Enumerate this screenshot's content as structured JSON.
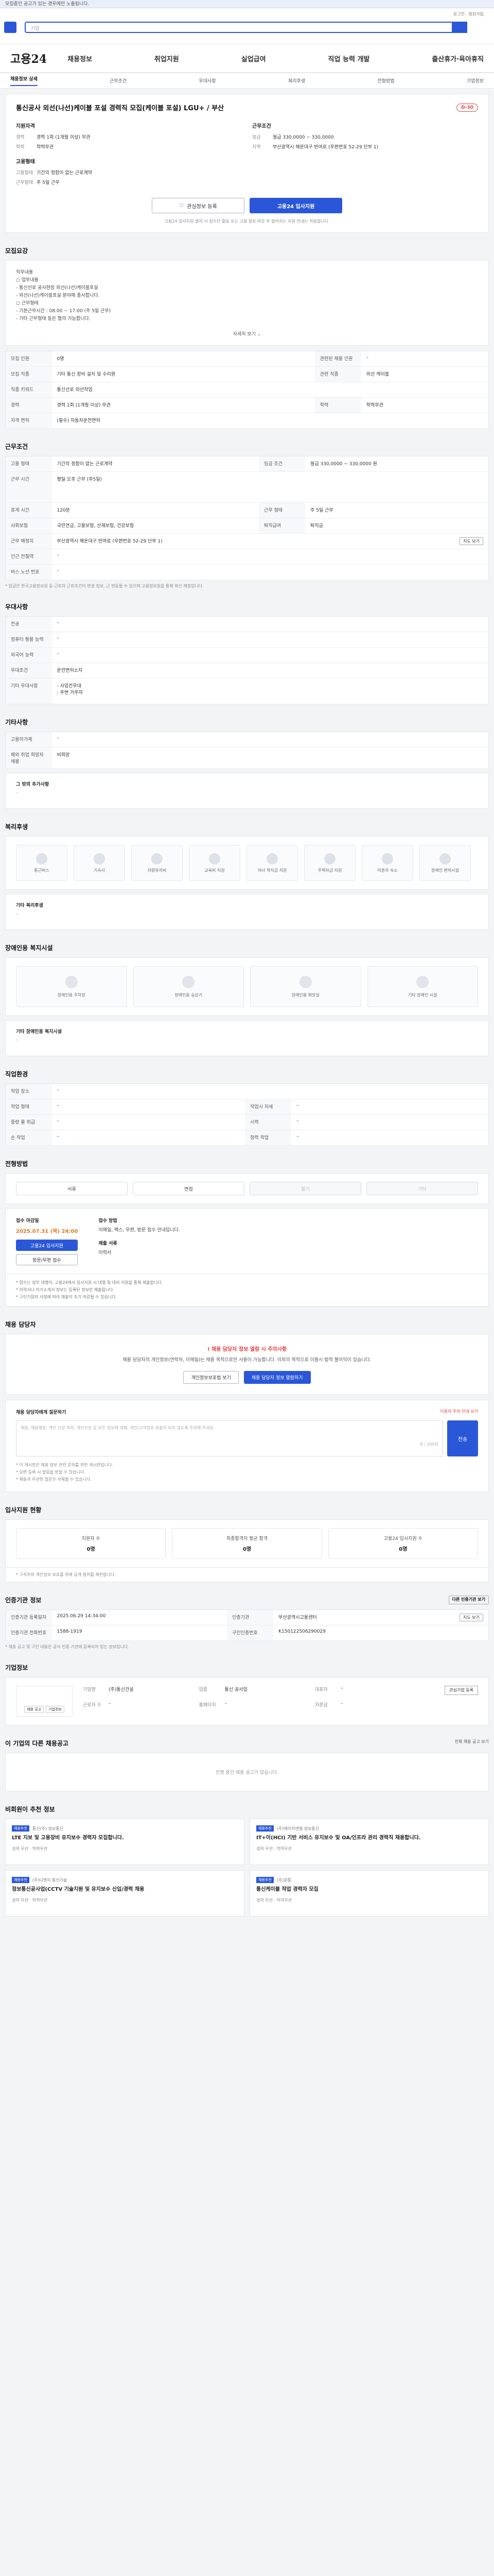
{
  "notice": "모집중인 공고가 있는 경우에만 노출됩니다.",
  "topbar": {
    "links": "로그인 · 회원가입",
    "search_placeholder": "기업"
  },
  "gnb": {
    "brand": "고용24",
    "menu": [
      "채용정보",
      "취업지원",
      "실업급여",
      "직업 능력 개발",
      "출산휴가·육아휴직"
    ]
  },
  "subnav": [
    "채용정보 상세",
    "근무조건",
    "우대사항",
    "복리후생",
    "전형방법",
    "기업정보"
  ],
  "job": {
    "title": "통신공사 외선(나선)케이블 포설 경력직 모집(케이블 포설) LGU+ / 부산",
    "dday": "D-30",
    "left_title": "지원자격",
    "left": [
      {
        "k": "경력",
        "v": "경력 1회 (1개월 이상) 무관"
      },
      {
        "k": "학력",
        "v": "학력무관"
      }
    ],
    "left2_title": "고용형태",
    "left2": [
      {
        "k": "고용형태",
        "v": "기간의 정함이 없는 근로계약"
      },
      {
        "k": "근무형태",
        "v": "주 5일 근무"
      }
    ],
    "right_title": "근무조건",
    "right": [
      {
        "k": "임금",
        "v": "월급 330,0000 ~ 330,0000"
      },
      {
        "k": "지역",
        "v": "부산광역시 해운대구 반여로 (우편번호 52-29 단부 1)"
      }
    ],
    "actions": {
      "fav": "관심정보 등록",
      "apply": "고용24 입사지원"
    },
    "action_note": "고용24 입사지원 클릭 시 접수단 활동 또는 고용 정보 마감 후 알려지는 지원 안내는 적용합니다."
  },
  "sections": {
    "recruit": "모집요강",
    "work": "근무조건",
    "pref": "우대사항",
    "other": "기타사항",
    "benefit": "복리후생",
    "disab": "장애인용 복지시설",
    "process": "직업환경",
    "method": "전형방법",
    "contact": "채용 담당자",
    "stats": "입사지원 현황",
    "register": "인증기관 정보",
    "company": "기업정보",
    "similar": "이 기업의 다른 채용공고",
    "reco": "비회원이 추천 정보"
  },
  "recruit_desc": [
    "직무내용",
    "○ 업무내용",
    "- 통신선로 공사현장 외선(나선)케이블포설",
    "- 외선(나선)케이블포설 분야에 종사합니다.",
    "○ 근무형태",
    "- 기본근무시간 : 08:00 ~ 17:00 (주 5일 근무)",
    "- 기타 근무형태 등은 협의 가능합니다."
  ],
  "expand": "자세히 보기",
  "recruit_table": [
    {
      "k": "모집 인원",
      "v": "0명",
      "k2": "관련된 채용 인원",
      "v2": "–"
    },
    {
      "k": "모집 직종",
      "v": "기타 통신 장비 설치 및 수리원",
      "k2": "관련 직종",
      "v2": "외선 케이블"
    },
    {
      "k": "직종 키워드",
      "v": "통신선로 외선작업",
      "k2": "",
      "v2": ""
    },
    {
      "k": "경력",
      "v": "경력 1회 (1개월 이상) 무관",
      "k2": "학력",
      "v2": "학력무관"
    },
    {
      "k": "자격 면허",
      "v": "(필수) 자동차운전면허",
      "k2": "",
      "v2": ""
    }
  ],
  "work_table": [
    {
      "k": "고용 형태",
      "v": "기간의 정함이 없는 근로계약",
      "k2": "임금 조건",
      "v2": "월급 330,0000 ~ 330,0000 원"
    },
    {
      "k": "근무 시간",
      "v": "평일 오후 근무 (주5일)",
      "k2": "",
      "v2": ""
    },
    {
      "k": "휴게 시간",
      "v": "120분",
      "k2": "근무 형태",
      "v2": "주 5일 근무"
    },
    {
      "k": "사회보험",
      "v": "국민연금, 고용보험, 산재보험, 건강보험",
      "k2": "퇴직급여",
      "v2": "퇴직금"
    },
    {
      "k": "근무 예정지",
      "v": "부산광역시 해운대구 반여로 (우편번호 52-29 단부 1)",
      "k2": "",
      "v2": ""
    },
    {
      "k": "인근 전철역",
      "v": "–",
      "k2": "",
      "v2": ""
    },
    {
      "k": "버스 노선 번호",
      "v": "–",
      "k2": "",
      "v2": ""
    }
  ],
  "map_btn": "지도 보기",
  "work_note": "* 임금은 한국고용정보원 등 근로자 근로조건이 변경 정보, 근 변동될 수 있으며 고용정보원을 통해 회신 예정입니다.",
  "pref_table": [
    {
      "k": "전공",
      "v": "–"
    },
    {
      "k": "컴퓨터 활용 능력",
      "v": "–"
    },
    {
      "k": "외국어 능력",
      "v": "–"
    },
    {
      "k": "우대조건",
      "v": "운전면허소지"
    },
    {
      "k": "기타 우대사항",
      "v": "- 사업전우대\n- 주변 거주자"
    }
  ],
  "other_table": [
    {
      "k": "고용허가제",
      "v": "–"
    },
    {
      "k": "해외 취업 희망자 채용",
      "v": "비희망"
    }
  ],
  "other_extra": "그 밖의 추가사항",
  "benefits": [
    "통근버스",
    "기숙사",
    "차량유지비",
    "교육비 지원",
    "자녀 학자금 지원",
    "주택자금 지원",
    "미혼자 숙소",
    "장애인 편의시설"
  ],
  "benefit_sub": {
    "h": "기타 복리후생",
    "d": "–"
  },
  "disab": [
    "장애인용 주차장",
    "장애인용 승강기",
    "장애인용 화장실",
    "기타 장애인 시설"
  ],
  "disab_sub": {
    "h": "기타 장애인용 복지시설",
    "d": "–"
  },
  "process_table": [
    {
      "k": "작업 장소",
      "v": "–",
      "k2": "",
      "v2": ""
    },
    {
      "k": "작업 형태",
      "v": "–",
      "k2": "작업시 자세",
      "v2": "–"
    },
    {
      "k": "중량 물 취급",
      "v": "–",
      "k2": "시력",
      "v2": "–"
    },
    {
      "k": "손 작업",
      "v": "–",
      "k2": "청력 작업",
      "v2": "–"
    }
  ],
  "methods": [
    "서류",
    "면접",
    "필기",
    "기타"
  ],
  "apply": {
    "h1": "접수 마감일",
    "date": "2025.07.31 (목) 24:00",
    "b1": "고용24 입사지원",
    "b2": "방문/우편 접수",
    "h2": "접수 방법",
    "p": "이메일, 팩스, 우편, 방문 접수 안내입니다.",
    "h3": "제출 서류",
    "d": "이력서"
  },
  "notes": [
    "* 접수는 정부 대행이, 고용24에서 입사지원 시 대행 및 대리 지원을 통해 제출합니다.",
    "* 이력서나 자기소개서 정보는 등록된 정보만 제출됩니다.",
    "* 구인기업의 사정에 따라 채용이 조기 마감될 수 있습니다."
  ],
  "contact": {
    "alert": "! 채용 담당자 정보 열람 시 주의사항",
    "p": "채용 담당자의 개인정보(연락처, 이메일)는 채용 목적으로만 사용이 가능합니다. 이외의 목적으로 이용시 법적 불이익이 있습니다.",
    "b1": "개인정보보호법 보기",
    "b2": "채용 담당자 정보 열람하기"
  },
  "qna": {
    "h": "채용 담당자에게 질문하기",
    "warn": "이용자 주의 안내 보기",
    "placeholder": "채용, 채용예정, 개인 신상 외의, 개인신상 등 모든 정보에 대해, 개인/고객정보 유출이 되지 않도록 주의해 주세요.",
    "count": "0 / 200자",
    "submit": "전송",
    "notes": [
      "* 이 게시판은 채용 정보 관련 문의를 위한 게시판입니다.",
      "* 답변 등록 시 알림을 받을 수 있습니다.",
      "* 채용과 무관한 질문은 삭제될 수 있습니다."
    ]
  },
  "stats": [
    {
      "l": "지원자 수",
      "n": "0명"
    },
    {
      "l": "최종합격자 평균 합격",
      "n": "0명"
    },
    {
      "l": "고용24 입사지원 수",
      "n": "0명"
    }
  ],
  "stats_note": "* 구직자의 개인정보 보호를 위해 공개 범위를 제한합니다.",
  "register_btn": "다른 인증기관 보기",
  "register_table": [
    {
      "k": "인증기관 등록일자",
      "v": "2025.06.29 14:34:00",
      "k2": "인증기관",
      "v2": "부산광역시고용센터",
      "btn": "지도 보기"
    },
    {
      "k": "인증기관 전화번호",
      "v": "1588-1919",
      "k2": "구인인증번호",
      "v2": "K150122506290029"
    }
  ],
  "register_note": "* 채용 공고 및 구인 내용은 공식 인증 기관에 등록되어 있는 정보입니다.",
  "company": {
    "logo_btns": [
      "채용 공고",
      "기업정보"
    ],
    "info": [
      {
        "k": "기업명",
        "v": "(주)통신건설"
      },
      {
        "k": "업종",
        "v": "통신 공사업"
      },
      {
        "k": "대표자",
        "v": "–"
      },
      {
        "k": "근로자 수",
        "v": "–"
      },
      {
        "k": "홈페이지",
        "v": "–"
      },
      {
        "k": "자본금",
        "v": "–"
      }
    ],
    "btn": "관심기업 등록"
  },
  "similar_empty": "진행 중인 채용 공고가 없습니다.",
  "similar_link": "전체 채용 공고 보기",
  "recos": [
    {
      "badge": "채용추천",
      "co": "통신(주) 정보통신",
      "t": "LTE 지보 및 고용장비 유지보수 경력자 모집합니다.",
      "tags": "경력 무관 · 학력무관"
    },
    {
      "badge": "채용추천",
      "co": "(주)에이치엔엘 정보통신",
      "t": "IT+이(HCI) 기반 서비스 유지보수 및 OA/인프라 관리 경력직 채용합니다.",
      "tags": "경력 무관 · 학력무관"
    },
    {
      "badge": "채용추천",
      "co": "(주)디엔지 통신기술",
      "t": "정보통신공사업(CCTV 기술지원 및 유지보수 신입/경력 채용",
      "tags": "경력 무관 · 학력무관"
    },
    {
      "badge": "채용추천",
      "co": "(주)원통",
      "t": "통신케이블 작업 경력자 모집",
      "tags": "경력 무관 · 학력무관"
    }
  ]
}
